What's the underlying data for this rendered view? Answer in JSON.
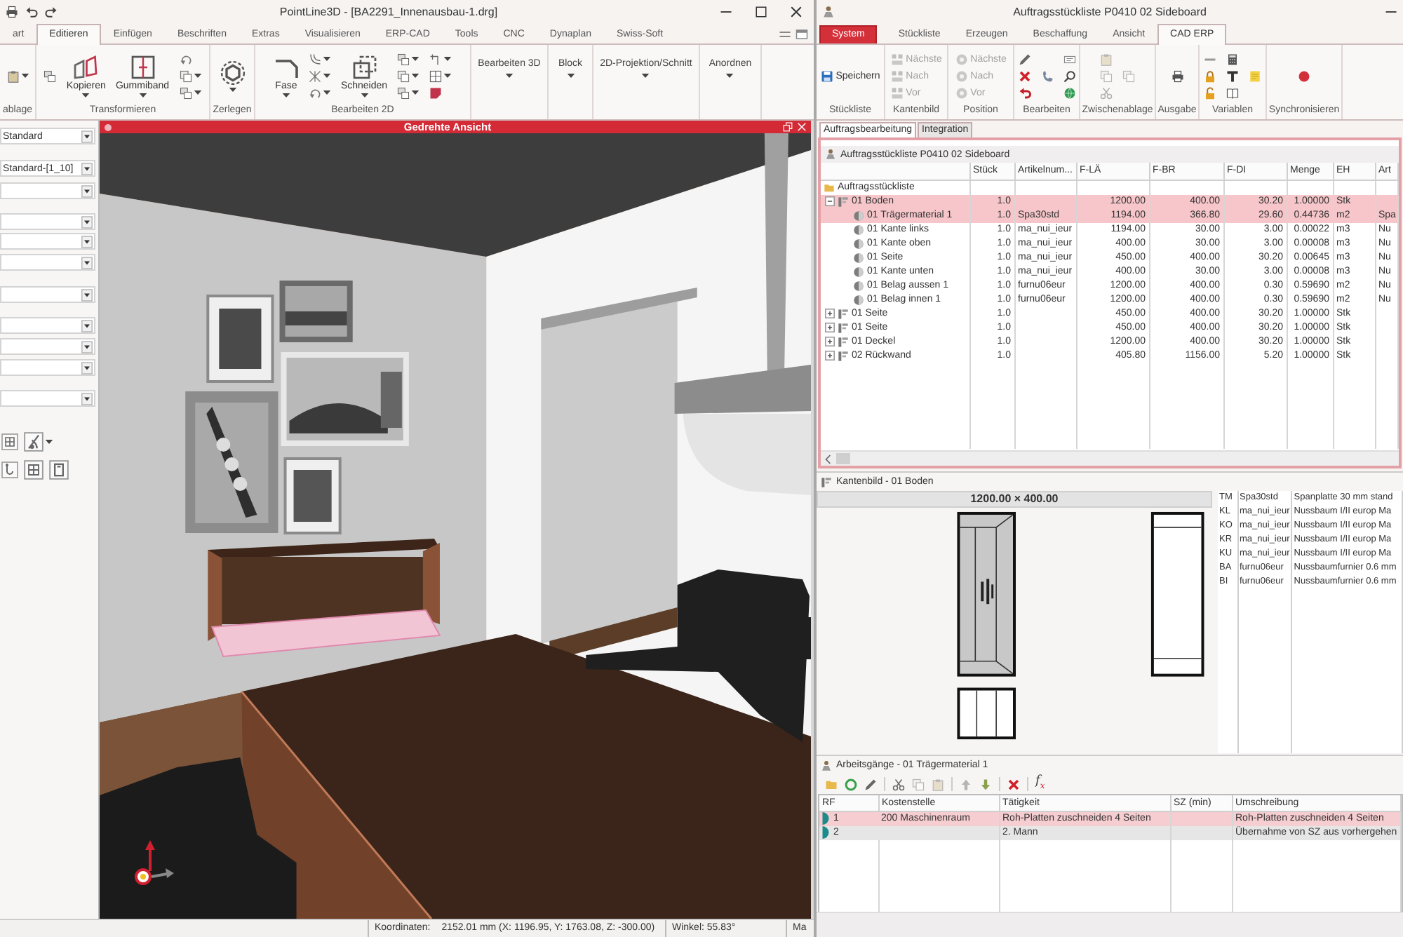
{
  "left_window": {
    "title": "PointLine3D - [BA2291_Innenausbau-1.drg]",
    "tabs": [
      {
        "label": "art",
        "selected": false
      },
      {
        "label": "Editieren",
        "selected": true
      },
      {
        "label": "Einfügen",
        "selected": false
      },
      {
        "label": "Beschriften",
        "selected": false
      },
      {
        "label": "Extras",
        "selected": false
      },
      {
        "label": "Visualisieren",
        "selected": false
      },
      {
        "label": "ERP-CAD",
        "selected": false
      },
      {
        "label": "Tools",
        "selected": false
      },
      {
        "label": "CNC",
        "selected": false
      },
      {
        "label": "Dynaplan",
        "selected": false
      },
      {
        "label": "Swiss-Soft",
        "selected": false
      }
    ],
    "ribbon": [
      {
        "kind": "group",
        "label": "ablage"
      },
      {
        "kind": "group",
        "label": "Transformieren",
        "buttons": [
          "Kopieren",
          "Gummiband"
        ]
      },
      {
        "kind": "group",
        "label": "Zerlegen"
      },
      {
        "kind": "group",
        "label": "Bearbeiten 2D",
        "buttons": [
          "Fase",
          "Schneiden"
        ]
      },
      {
        "kind": "menu",
        "label": "Bearbeiten 3D"
      },
      {
        "kind": "menu",
        "label": "Block"
      },
      {
        "kind": "menu",
        "label": "2D-Projektion/Schnitt"
      },
      {
        "kind": "menu",
        "label": "Anordnen"
      }
    ],
    "side_panel": {
      "fields": [
        {
          "value": "Standard"
        },
        {
          "value": "Standard-[1_10]"
        }
      ]
    },
    "viewport": {
      "title": "Gedrehte Ansicht"
    },
    "status_bar": {
      "coordinates_label": "Koordinaten:",
      "coordinates": "2152.01 mm (X: 1196.95, Y: 1763.08, Z: -300.00)",
      "angle": "Winkel: 55.83°",
      "column_4": "Ma"
    }
  },
  "right_window": {
    "title": "Auftragsstückliste P0410 02 Sideboard",
    "tabs": [
      {
        "label": "System",
        "kind": "menu",
        "selected": false
      },
      {
        "label": "Stückliste",
        "kind": "tab",
        "selected": false
      },
      {
        "label": "Erzeugen",
        "kind": "tab",
        "selected": false
      },
      {
        "label": "Beschaffung",
        "kind": "tab",
        "selected": false
      },
      {
        "label": "Ansicht",
        "kind": "tab",
        "selected": false
      },
      {
        "label": "CAD ERP",
        "kind": "tab",
        "selected": true
      }
    ],
    "ribbon": [
      {
        "label": "Stückliste",
        "buttons": [
          {
            "label": "Speichern",
            "disabled": false
          }
        ]
      },
      {
        "label": "Kantenbild",
        "buttons": [
          {
            "label": "Nächste",
            "disabled": true
          },
          {
            "label": "Nach",
            "disabled": true
          },
          {
            "label": "Vor",
            "disabled": true
          }
        ]
      },
      {
        "label": "Position",
        "buttons": [
          {
            "label": "Nächste",
            "disabled": true
          },
          {
            "label": "Nach",
            "disabled": true
          },
          {
            "label": "Vor",
            "disabled": true
          }
        ]
      },
      {
        "label": "Bearbeiten"
      },
      {
        "label": "Zwischenablage"
      },
      {
        "label": "Ausgabe"
      },
      {
        "label": "Variablen"
      },
      {
        "label": "Synchronisieren"
      }
    ],
    "view_tabs": [
      {
        "label": "Auftragsbearbeitung",
        "selected": true
      },
      {
        "label": "Integration",
        "selected": false
      }
    ],
    "parts_list": {
      "title": "Auftragsstückliste P0410 02 Sideboard",
      "columns": [
        "Stück",
        "Artikelnum...",
        "F-LÄ",
        "F-BR",
        "F-DI",
        "Menge",
        "EH",
        "Art"
      ],
      "rows": [
        {
          "name": "Auftragsstückliste",
          "selected": false,
          "children": [
            {
              "name": "01 Boden",
              "expanded": true,
              "selected": true,
              "cells": [
                "1.0",
                null,
                "1200.00",
                "400.00",
                "30.20",
                "1.00000",
                "Stk",
                null
              ],
              "children": [
                {
                  "name": "01 Trägermaterial 1",
                  "selected": true,
                  "cells": [
                    "1.0",
                    "Spa30std",
                    "1194.00",
                    "366.80",
                    "29.60",
                    "0.44736",
                    "m2",
                    "Spa"
                  ]
                },
                {
                  "name": "01 Kante links",
                  "selected": false,
                  "cells": [
                    "1.0",
                    "ma_nui_ieur",
                    "1194.00",
                    "30.00",
                    "3.00",
                    "0.00022",
                    "m3",
                    "Nu"
                  ]
                },
                {
                  "name": "01 Kante oben",
                  "selected": false,
                  "cells": [
                    "1.0",
                    "ma_nui_ieur",
                    "400.00",
                    "30.00",
                    "3.00",
                    "0.00008",
                    "m3",
                    "Nu"
                  ]
                },
                {
                  "name": "01 Seite",
                  "selected": false,
                  "cells": [
                    "1.0",
                    "ma_nui_ieur",
                    "450.00",
                    "400.00",
                    "30.20",
                    "0.00645",
                    "m3",
                    "Nu"
                  ]
                },
                {
                  "name": "01 Kante unten",
                  "selected": false,
                  "cells": [
                    "1.0",
                    "ma_nui_ieur",
                    "400.00",
                    "30.00",
                    "3.00",
                    "0.00008",
                    "m3",
                    "Nu"
                  ]
                },
                {
                  "name": "01 Belag aussen 1",
                  "selected": false,
                  "cells": [
                    "1.0",
                    "furnu06eur",
                    "1200.00",
                    "400.00",
                    "0.30",
                    "0.59690",
                    "m2",
                    "Nu"
                  ]
                },
                {
                  "name": "01 Belag innen 1",
                  "selected": false,
                  "cells": [
                    "1.0",
                    "furnu06eur",
                    "1200.00",
                    "400.00",
                    "0.30",
                    "0.59690",
                    "m2",
                    "Nu"
                  ]
                }
              ]
            },
            {
              "name": "01 Seite",
              "expanded": false,
              "selected": false,
              "cells": [
                "1.0",
                null,
                "450.00",
                "400.00",
                "30.20",
                "1.00000",
                "Stk",
                null
              ]
            },
            {
              "name": "01 Seite",
              "expanded": false,
              "selected": false,
              "cells": [
                "1.0",
                null,
                "450.00",
                "400.00",
                "30.20",
                "1.00000",
                "Stk",
                null
              ]
            },
            {
              "name": "01 Deckel",
              "expanded": false,
              "selected": false,
              "cells": [
                "1.0",
                null,
                "1200.00",
                "400.00",
                "30.20",
                "1.00000",
                "Stk",
                null
              ]
            },
            {
              "name": "02 Rückwand",
              "expanded": false,
              "selected": false,
              "cells": [
                "1.0",
                null,
                "405.80",
                "1156.00",
                "5.20",
                "1.00000",
                "Stk",
                null
              ]
            }
          ]
        }
      ]
    },
    "edge_view": {
      "title": "Kantenbild - 01 Boden",
      "dimensions": "1200.00 × 400.00",
      "edges": [
        {
          "code": "TM",
          "article": "Spa30std",
          "description": "Spanplatte 30 mm stand"
        },
        {
          "code": "KL",
          "article": "ma_nui_ieur",
          "description": "Nussbaum I/II europ Ma"
        },
        {
          "code": "KO",
          "article": "ma_nui_ieur",
          "description": "Nussbaum I/II europ Ma"
        },
        {
          "code": "KR",
          "article": "ma_nui_ieur",
          "description": "Nussbaum I/II europ Ma"
        },
        {
          "code": "KU",
          "article": "ma_nui_ieur",
          "description": "Nussbaum I/II europ Ma"
        },
        {
          "code": "BA",
          "article": "furnu06eur",
          "description": "Nussbaumfurnier 0.6 mm"
        },
        {
          "code": "BI",
          "article": "furnu06eur",
          "description": "Nussbaumfurnier 0.6 mm"
        }
      ]
    },
    "operations": {
      "title": "Arbeitsgänge - 01 Trägermaterial 1",
      "formula_button": "f$_{x}$",
      "columns": [
        "RF",
        "Kostenstelle",
        "Tätigkeit",
        "SZ (min)",
        "Umschreibung"
      ],
      "rows": [
        {
          "selected": true,
          "cells": [
            "1",
            "200 Maschinenraum",
            "Roh-Platten zuschneiden 4 Seiten",
            null,
            "Roh-Platten zuschneiden 4 Seiten"
          ]
        },
        {
          "selected": false,
          "cells": [
            "2",
            null,
            "2. Mann",
            null,
            "Übernahme von SZ aus vorhergehen"
          ]
        }
      ]
    }
  }
}
